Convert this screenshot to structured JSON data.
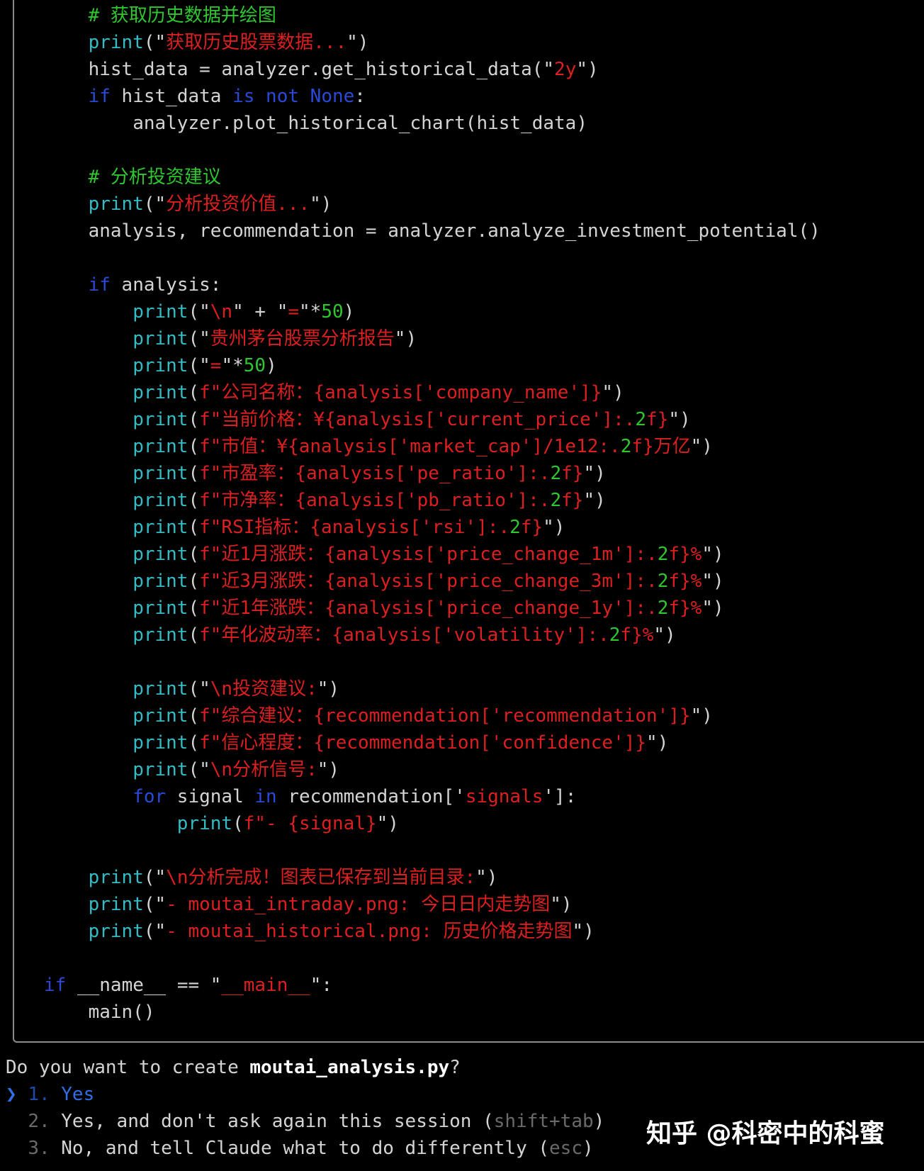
{
  "code": {
    "lines": [
      {
        "i": 1,
        "segs": [
          {
            "c": "c",
            "t": "# 获取历史数据并绘图"
          }
        ]
      },
      {
        "i": 1,
        "segs": [
          {
            "c": "p",
            "t": "print"
          },
          {
            "c": "d",
            "t": "(\""
          },
          {
            "c": "s",
            "t": "获取历史股票数据..."
          },
          {
            "c": "d",
            "t": "\")"
          }
        ]
      },
      {
        "i": 1,
        "segs": [
          {
            "c": "d",
            "t": "hist_data = analyzer.get_historical_data(\""
          },
          {
            "c": "s",
            "t": "2y"
          },
          {
            "c": "d",
            "t": "\")"
          }
        ]
      },
      {
        "i": 1,
        "segs": [
          {
            "c": "k",
            "t": "if"
          },
          {
            "c": "d",
            "t": " hist_data "
          },
          {
            "c": "k",
            "t": "is not None"
          },
          {
            "c": "d",
            "t": ":"
          }
        ]
      },
      {
        "i": 2,
        "segs": [
          {
            "c": "d",
            "t": "analyzer.plot_historical_chart(hist_data)"
          }
        ]
      },
      {
        "i": 0,
        "segs": []
      },
      {
        "i": 1,
        "segs": [
          {
            "c": "c",
            "t": "# 分析投资建议"
          }
        ]
      },
      {
        "i": 1,
        "segs": [
          {
            "c": "p",
            "t": "print"
          },
          {
            "c": "d",
            "t": "(\""
          },
          {
            "c": "s",
            "t": "分析投资价值..."
          },
          {
            "c": "d",
            "t": "\")"
          }
        ]
      },
      {
        "i": 1,
        "segs": [
          {
            "c": "d",
            "t": "analysis, recommendation = analyzer.analyze_investment_potential()"
          }
        ]
      },
      {
        "i": 0,
        "segs": []
      },
      {
        "i": 1,
        "segs": [
          {
            "c": "k",
            "t": "if"
          },
          {
            "c": "d",
            "t": " analysis:"
          }
        ]
      },
      {
        "i": 2,
        "segs": [
          {
            "c": "p",
            "t": "print"
          },
          {
            "c": "d",
            "t": "(\""
          },
          {
            "c": "s",
            "t": "\\n"
          },
          {
            "c": "d",
            "t": "\" + \""
          },
          {
            "c": "s",
            "t": "="
          },
          {
            "c": "d",
            "t": "\"*"
          },
          {
            "c": "n",
            "t": "50"
          },
          {
            "c": "d",
            "t": ")"
          }
        ]
      },
      {
        "i": 2,
        "segs": [
          {
            "c": "p",
            "t": "print"
          },
          {
            "c": "d",
            "t": "(\""
          },
          {
            "c": "s",
            "t": "贵州茅台股票分析报告"
          },
          {
            "c": "d",
            "t": "\")"
          }
        ]
      },
      {
        "i": 2,
        "segs": [
          {
            "c": "p",
            "t": "print"
          },
          {
            "c": "d",
            "t": "(\""
          },
          {
            "c": "s",
            "t": "="
          },
          {
            "c": "d",
            "t": "\"*"
          },
          {
            "c": "n",
            "t": "50"
          },
          {
            "c": "d",
            "t": ")"
          }
        ]
      },
      {
        "i": 2,
        "segs": [
          {
            "c": "p",
            "t": "print"
          },
          {
            "c": "d",
            "t": "("
          },
          {
            "c": "s",
            "t": "f\"公司名称：{analysis['company_name']}"
          },
          {
            "c": "d",
            "t": "\")"
          }
        ]
      },
      {
        "i": 2,
        "segs": [
          {
            "c": "p",
            "t": "print"
          },
          {
            "c": "d",
            "t": "("
          },
          {
            "c": "s",
            "t": "f\"当前价格：¥{analysis['current_price']:."
          },
          {
            "c": "n",
            "t": "2"
          },
          {
            "c": "s",
            "t": "f}"
          },
          {
            "c": "d",
            "t": "\")"
          }
        ]
      },
      {
        "i": 2,
        "segs": [
          {
            "c": "p",
            "t": "print"
          },
          {
            "c": "d",
            "t": "("
          },
          {
            "c": "s",
            "t": "f\"市值：¥{analysis['market_cap']/1e12:."
          },
          {
            "c": "n",
            "t": "2"
          },
          {
            "c": "s",
            "t": "f}万亿"
          },
          {
            "c": "d",
            "t": "\")"
          }
        ]
      },
      {
        "i": 2,
        "segs": [
          {
            "c": "p",
            "t": "print"
          },
          {
            "c": "d",
            "t": "("
          },
          {
            "c": "s",
            "t": "f\"市盈率：{analysis['pe_ratio']:."
          },
          {
            "c": "n",
            "t": "2"
          },
          {
            "c": "s",
            "t": "f}"
          },
          {
            "c": "d",
            "t": "\")"
          }
        ]
      },
      {
        "i": 2,
        "segs": [
          {
            "c": "p",
            "t": "print"
          },
          {
            "c": "d",
            "t": "("
          },
          {
            "c": "s",
            "t": "f\"市净率：{analysis['pb_ratio']:."
          },
          {
            "c": "n",
            "t": "2"
          },
          {
            "c": "s",
            "t": "f}"
          },
          {
            "c": "d",
            "t": "\")"
          }
        ]
      },
      {
        "i": 2,
        "segs": [
          {
            "c": "p",
            "t": "print"
          },
          {
            "c": "d",
            "t": "("
          },
          {
            "c": "s",
            "t": "f\"RSI指标：{analysis['rsi']:."
          },
          {
            "c": "n",
            "t": "2"
          },
          {
            "c": "s",
            "t": "f}"
          },
          {
            "c": "d",
            "t": "\")"
          }
        ]
      },
      {
        "i": 2,
        "segs": [
          {
            "c": "p",
            "t": "print"
          },
          {
            "c": "d",
            "t": "("
          },
          {
            "c": "s",
            "t": "f\"近1月涨跌：{analysis['price_change_1m']:."
          },
          {
            "c": "n",
            "t": "2"
          },
          {
            "c": "s",
            "t": "f}%"
          },
          {
            "c": "d",
            "t": "\")"
          }
        ]
      },
      {
        "i": 2,
        "segs": [
          {
            "c": "p",
            "t": "print"
          },
          {
            "c": "d",
            "t": "("
          },
          {
            "c": "s",
            "t": "f\"近3月涨跌：{analysis['price_change_3m']:."
          },
          {
            "c": "n",
            "t": "2"
          },
          {
            "c": "s",
            "t": "f}%"
          },
          {
            "c": "d",
            "t": "\")"
          }
        ]
      },
      {
        "i": 2,
        "segs": [
          {
            "c": "p",
            "t": "print"
          },
          {
            "c": "d",
            "t": "("
          },
          {
            "c": "s",
            "t": "f\"近1年涨跌：{analysis['price_change_1y']:."
          },
          {
            "c": "n",
            "t": "2"
          },
          {
            "c": "s",
            "t": "f}%"
          },
          {
            "c": "d",
            "t": "\")"
          }
        ]
      },
      {
        "i": 2,
        "segs": [
          {
            "c": "p",
            "t": "print"
          },
          {
            "c": "d",
            "t": "("
          },
          {
            "c": "s",
            "t": "f\"年化波动率：{analysis['volatility']:."
          },
          {
            "c": "n",
            "t": "2"
          },
          {
            "c": "s",
            "t": "f}%"
          },
          {
            "c": "d",
            "t": "\")"
          }
        ]
      },
      {
        "i": 0,
        "segs": []
      },
      {
        "i": 2,
        "segs": [
          {
            "c": "p",
            "t": "print"
          },
          {
            "c": "d",
            "t": "(\""
          },
          {
            "c": "s",
            "t": "\\n投资建议:"
          },
          {
            "c": "d",
            "t": "\")"
          }
        ]
      },
      {
        "i": 2,
        "segs": [
          {
            "c": "p",
            "t": "print"
          },
          {
            "c": "d",
            "t": "("
          },
          {
            "c": "s",
            "t": "f\"综合建议：{recommendation['recommendation']}"
          },
          {
            "c": "d",
            "t": "\")"
          }
        ]
      },
      {
        "i": 2,
        "segs": [
          {
            "c": "p",
            "t": "print"
          },
          {
            "c": "d",
            "t": "("
          },
          {
            "c": "s",
            "t": "f\"信心程度：{recommendation['confidence']}"
          },
          {
            "c": "d",
            "t": "\")"
          }
        ]
      },
      {
        "i": 2,
        "segs": [
          {
            "c": "p",
            "t": "print"
          },
          {
            "c": "d",
            "t": "(\""
          },
          {
            "c": "s",
            "t": "\\n分析信号:"
          },
          {
            "c": "d",
            "t": "\")"
          }
        ]
      },
      {
        "i": 2,
        "segs": [
          {
            "c": "k",
            "t": "for"
          },
          {
            "c": "d",
            "t": " signal "
          },
          {
            "c": "k",
            "t": "in"
          },
          {
            "c": "d",
            "t": " recommendation['"
          },
          {
            "c": "s",
            "t": "signals"
          },
          {
            "c": "d",
            "t": "']:"
          }
        ]
      },
      {
        "i": 3,
        "segs": [
          {
            "c": "p",
            "t": "print"
          },
          {
            "c": "d",
            "t": "("
          },
          {
            "c": "s",
            "t": "f\"- {signal}"
          },
          {
            "c": "d",
            "t": "\")"
          }
        ]
      },
      {
        "i": 0,
        "segs": []
      },
      {
        "i": 1,
        "segs": [
          {
            "c": "p",
            "t": "print"
          },
          {
            "c": "d",
            "t": "(\""
          },
          {
            "c": "s",
            "t": "\\n分析完成！图表已保存到当前目录:"
          },
          {
            "c": "d",
            "t": "\")"
          }
        ]
      },
      {
        "i": 1,
        "segs": [
          {
            "c": "p",
            "t": "print"
          },
          {
            "c": "d",
            "t": "(\""
          },
          {
            "c": "s",
            "t": "- moutai_intraday.png: 今日日内走势图"
          },
          {
            "c": "d",
            "t": "\")"
          }
        ]
      },
      {
        "i": 1,
        "segs": [
          {
            "c": "p",
            "t": "print"
          },
          {
            "c": "d",
            "t": "(\""
          },
          {
            "c": "s",
            "t": "- moutai_historical.png: 历史价格走势图"
          },
          {
            "c": "d",
            "t": "\")"
          }
        ]
      },
      {
        "i": 0,
        "segs": []
      },
      {
        "i": 0,
        "segs": [
          {
            "c": "k",
            "t": "if"
          },
          {
            "c": "d",
            "t": " __name__ == \""
          },
          {
            "c": "s",
            "t": "__main__"
          },
          {
            "c": "d",
            "t": "\":"
          }
        ]
      },
      {
        "i": 1,
        "segs": [
          {
            "c": "d",
            "t": "main()"
          }
        ]
      }
    ]
  },
  "prompt": {
    "question_prefix": "Do you want to create ",
    "filename": "moutai_analysis.py",
    "question_suffix": "?",
    "cursor": "❯",
    "options": [
      {
        "num": "1.",
        "label": "Yes",
        "hint": "",
        "selected": true
      },
      {
        "num": "2.",
        "label": "Yes, and don't ask again this session (",
        "hint": "shift+tab",
        "close": ")"
      },
      {
        "num": "3.",
        "label": "No, and tell Claude what to do differently (",
        "hint": "esc",
        "close": ")"
      }
    ]
  },
  "watermark": "知乎 @科密中的科蜜"
}
